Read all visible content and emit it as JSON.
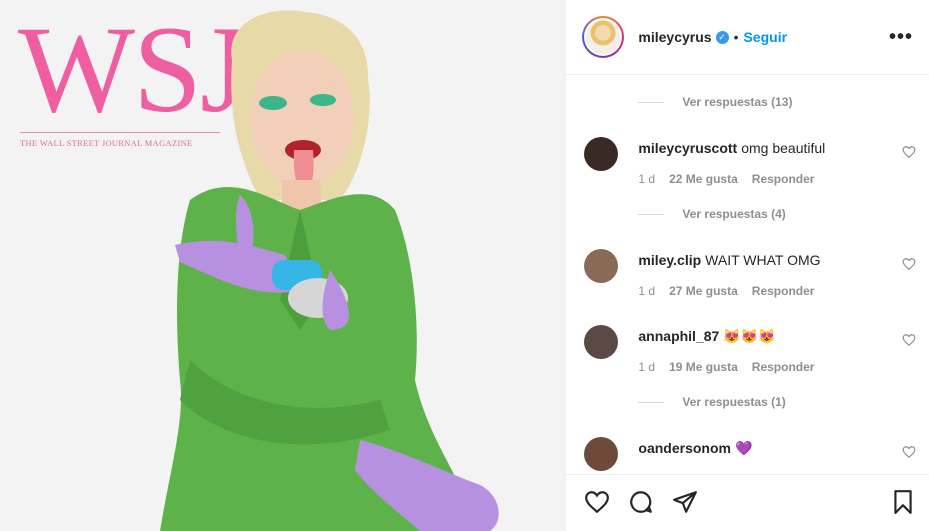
{
  "post": {
    "magazine_logo": "WSJ.",
    "magazine_tagline": "THE WALL STREET JOURNAL MAGAZINE"
  },
  "header": {
    "username": "mileycyrus",
    "verified": true,
    "separator": "•",
    "follow_label": "Seguir",
    "more_label": "•••"
  },
  "comments": [
    {
      "type": "replies",
      "label": "Ver respuestas (13)"
    },
    {
      "type": "comment",
      "user": "mileycyruscott",
      "text": "omg beautiful",
      "time": "1 d",
      "likes": "22 Me gusta",
      "reply": "Responder",
      "avatar_color": "#3a2a24"
    },
    {
      "type": "replies",
      "label": "Ver respuestas (4)"
    },
    {
      "type": "comment",
      "user": "miley.clip",
      "text": "WAIT WHAT OMG",
      "time": "1 d",
      "likes": "27 Me gusta",
      "reply": "Responder",
      "avatar_color": "#8a6a55"
    },
    {
      "type": "comment",
      "user": "annaphil_87",
      "text": "😻😻😻",
      "time": "1 d",
      "likes": "19 Me gusta",
      "reply": "Responder",
      "avatar_color": "#5b4a44"
    },
    {
      "type": "replies",
      "label": "Ver respuestas (1)"
    },
    {
      "type": "comment",
      "user": "oandersonom",
      "text": "💜",
      "time": "",
      "likes": "",
      "reply": "",
      "avatar_color": "#6d4a3a"
    }
  ],
  "actions": {
    "like_icon": "heart-icon",
    "comment_icon": "comment-icon",
    "share_icon": "share-icon",
    "save_icon": "bookmark-icon"
  },
  "colors": {
    "accent": "#0095f6",
    "magazine_pink": "#ef5ea0",
    "coat_green": "#5db34a",
    "glove_purple": "#b890e0"
  }
}
